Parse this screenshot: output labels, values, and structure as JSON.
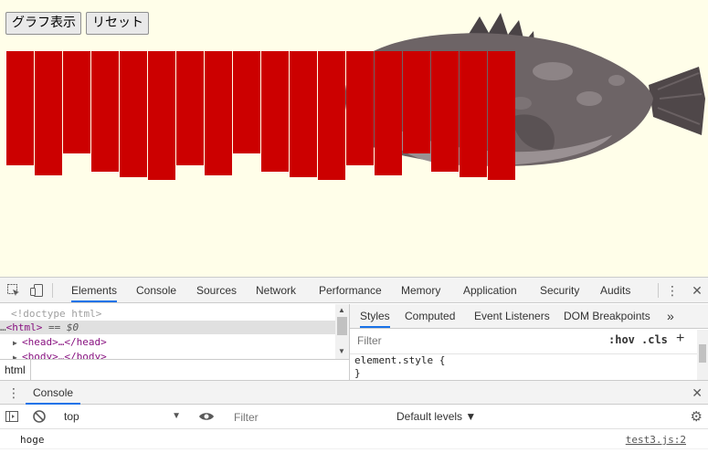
{
  "page": {
    "background": "#fffee9",
    "buttons": {
      "graph_label": "グラフ表示",
      "reset_label": "リセット"
    },
    "bar_color": "#cc0000",
    "bars": [
      {
        "value": 125
      },
      {
        "value": 136
      },
      {
        "value": 112
      },
      {
        "value": 132
      },
      {
        "value": 138
      },
      {
        "value": 141
      },
      {
        "value": 125
      },
      {
        "value": 136
      },
      {
        "value": 112
      },
      {
        "value": 132
      },
      {
        "value": 138
      },
      {
        "value": 141
      },
      {
        "value": 125
      },
      {
        "value": 136
      },
      {
        "value": 112
      },
      {
        "value": 132
      },
      {
        "value": 138
      },
      {
        "value": 141
      }
    ]
  },
  "devtools": {
    "tabs": [
      "Elements",
      "Console",
      "Sources",
      "Network",
      "Performance",
      "Memory",
      "Application",
      "Security",
      "Audits"
    ],
    "active_tab": "Elements",
    "dom_tree": {
      "doctype": "<!doctype html>",
      "html_line": "<html>",
      "selected_marker": "== $0",
      "head_line": "<head>…</head>",
      "body_line": "<body>…</body>",
      "ellipsis": "…"
    },
    "breadcrumb": "html",
    "styles_tabs": [
      "Styles",
      "Computed",
      "Event Listeners",
      "DOM Breakpoints"
    ],
    "styles_more": "»",
    "styles_filter_placeholder": "Filter",
    "hov": ":hov",
    "cls": ".cls",
    "plus": "+",
    "style_rule": {
      "selector": "element.style {",
      "close": "}"
    },
    "drawer": {
      "tab": "Console",
      "context": "top",
      "filter_placeholder": "Filter",
      "levels": "Default levels ▼",
      "message": "hoge",
      "source": "test3.js:2"
    }
  }
}
